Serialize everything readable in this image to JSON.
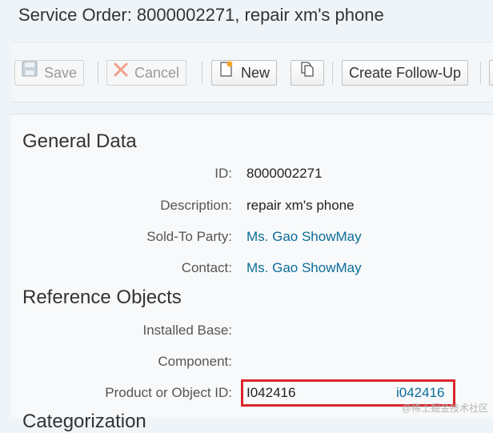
{
  "page_title": "Service Order: 8000002271, repair xm's phone",
  "toolbar": {
    "save_label": "Save",
    "cancel_label": "Cancel",
    "new_label": "New",
    "follow_up_label": "Create Follow-Up"
  },
  "general_data": {
    "heading": "General Data",
    "id_label": "ID:",
    "id_value": "8000002271",
    "description_label": "Description:",
    "description_value": "repair xm's phone",
    "sold_to_label": "Sold-To Party:",
    "sold_to_value": "Ms. Gao ShowMay",
    "contact_label": "Contact:",
    "contact_value": "Ms. Gao ShowMay"
  },
  "reference_objects": {
    "heading": "Reference Objects",
    "installed_base_label": "Installed Base:",
    "component_label": "Component:",
    "product_label": "Product or Object ID:",
    "product_input_value": "I042416",
    "product_link": "i042416"
  },
  "next_section_partial": "Categorization",
  "watermark": "@稀土掘金技术社区",
  "colors": {
    "link": "#0c6d99",
    "highlight_border": "#d9262c"
  }
}
